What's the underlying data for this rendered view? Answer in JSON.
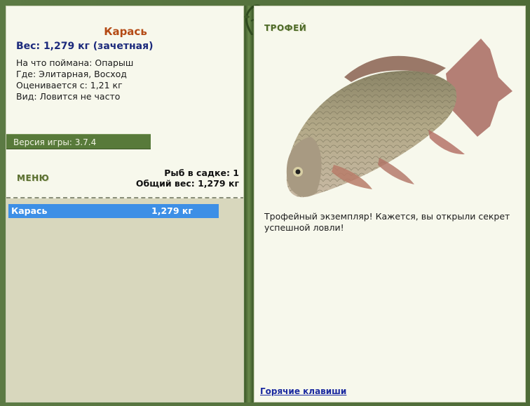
{
  "catch": {
    "fish_name": "Карась",
    "weight_line": "Вес: 1,279 кг (зачетная)",
    "bait": "На что поймана: Опарыш",
    "location": "Где: Элитарная, Восход",
    "valued_from": "Оценивается с: 1,21 кг",
    "view": "Вид: Ловится не часто"
  },
  "version": "Версия игры: 3.7.4",
  "menu_label": "МЕНЮ",
  "keep": {
    "count_line": "Рыб в садке: 1",
    "total_line": "Общий вес: 1,279 кг"
  },
  "list": [
    {
      "name": "Карась",
      "weight": "1,279 кг"
    }
  ],
  "trophy": {
    "label": "ТРОФЕЙ",
    "text": "Трофейный экземпляр! Кажется, вы открыли секрет успешной ловли!"
  },
  "hotkeys_label": "Горячие клавиши",
  "colors": {
    "frame_green": "#4f6a3a",
    "panel_bg": "#f7f8ec",
    "title_orange": "#b44a15",
    "weight_blue": "#1c2a7c",
    "selected_blue": "#3d8fe6"
  }
}
